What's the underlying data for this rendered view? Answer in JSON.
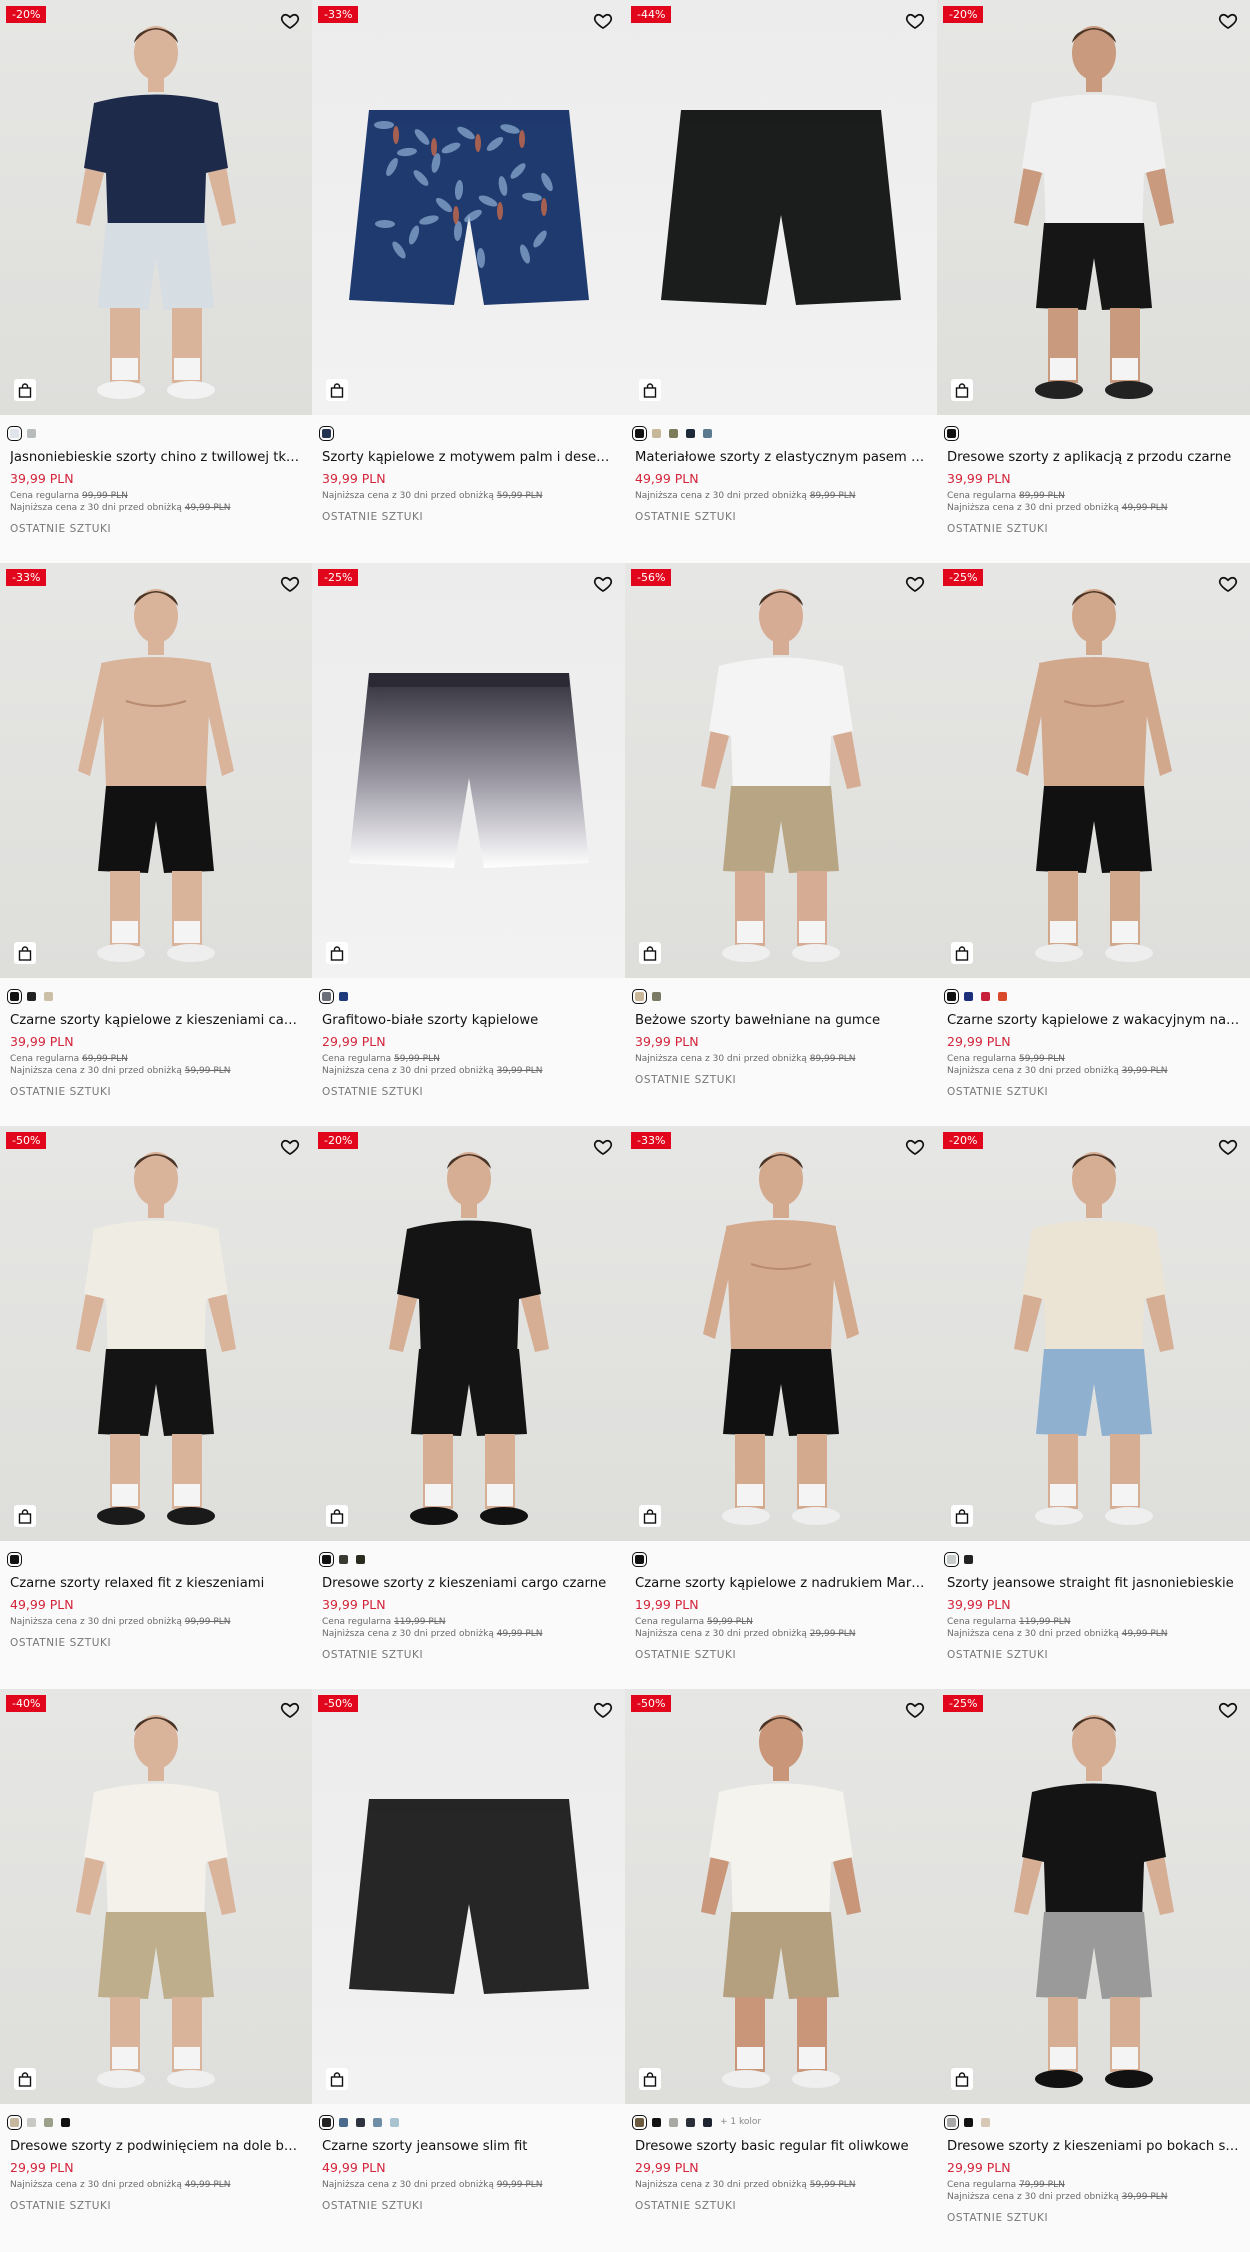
{
  "colors": {
    "sale_badge": "#e1061b",
    "price": "#d3243a",
    "background": "#fafafa"
  },
  "products": [
    {
      "discount": "-20%",
      "name": "Jasnoniebieskie szorty chino z twillowej tkaniny",
      "price": "39,99 PLN",
      "regular_label": "Cena regularna",
      "regular_price": "99,99 PLN",
      "lowest_label": "Najniższa cena z 30 dni przed obniżką",
      "lowest_price": "49,99 PLN",
      "tag": "OSTATNIE SZTUKI",
      "swatches": [
        "#dfe5ea",
        "#b8bbbb"
      ],
      "more": "",
      "image": {
        "type": "model",
        "top": "#1e2a4a",
        "shorts": "#d6dde3",
        "skin": "#d9b39a",
        "shoes": "#f2f2f2"
      }
    },
    {
      "discount": "-33%",
      "name": "Szorty kąpielowe z motywem palm i desek surfingowych",
      "price": "39,99 PLN",
      "regular_label": "",
      "regular_price": "",
      "lowest_label": "Najniższa cena z 30 dni przed obniżką",
      "lowest_price": "59,99 PLN",
      "tag": "OSTATNIE SZTUKI",
      "swatches": [
        "#243350"
      ],
      "more": "",
      "image": {
        "type": "flat",
        "shorts": "#1f3a6e",
        "pattern": "#8fb0d6"
      }
    },
    {
      "discount": "-44%",
      "name": "Materiałowe szorty z elastycznym pasem czarne",
      "price": "49,99 PLN",
      "regular_label": "",
      "regular_price": "",
      "lowest_label": "Najniższa cena z 30 dni przed obniżką",
      "lowest_price": "89,99 PLN",
      "tag": "OSTATNIE SZTUKI",
      "swatches": [
        "#111111",
        "#c8b89a",
        "#7d7c5a",
        "#1e2a3a",
        "#5b7a8e"
      ],
      "more": "",
      "image": {
        "type": "flat",
        "shorts": "#1b1d1c",
        "pattern": ""
      }
    },
    {
      "discount": "-20%",
      "name": "Dresowe szorty z aplikacją z przodu czarne",
      "price": "39,99 PLN",
      "regular_label": "Cena regularna",
      "regular_price": "89,99 PLN",
      "lowest_label": "Najniższa cena z 30 dni przed obniżką",
      "lowest_price": "49,99 PLN",
      "tag": "OSTATNIE SZTUKI",
      "swatches": [
        "#111111"
      ],
      "more": "",
      "image": {
        "type": "model",
        "top": "#f0f0f0",
        "shorts": "#161616",
        "skin": "#c99a7d",
        "shoes": "#222222"
      }
    },
    {
      "discount": "-33%",
      "name": "Czarne szorty kąpielowe z kieszeniami cargo",
      "price": "39,99 PLN",
      "regular_label": "Cena regularna",
      "regular_price": "69,99 PLN",
      "lowest_label": "Najniższa cena z 30 dni przed obniżką",
      "lowest_price": "59,99 PLN",
      "tag": "OSTATNIE SZTUKI",
      "swatches": [
        "#111111",
        "#222222",
        "#cbbfa6"
      ],
      "more": "",
      "image": {
        "type": "shirtless",
        "top": "#d9b39a",
        "shorts": "#111111",
        "skin": "#d9b39a",
        "shoes": ""
      }
    },
    {
      "discount": "-25%",
      "name": "Grafitowo-białe szorty kąpielowe",
      "price": "29,99 PLN",
      "regular_label": "Cena regularna",
      "regular_price": "59,99 PLN",
      "lowest_label": "Najniższa cena z 30 dni przed obniżką",
      "lowest_price": "39,99 PLN",
      "tag": "OSTATNIE SZTUKI",
      "swatches": [
        "#6a6e78",
        "#1d3a7a"
      ],
      "more": "",
      "image": {
        "type": "flat",
        "shorts": "#3a3944",
        "pattern": "gradient"
      }
    },
    {
      "discount": "-56%",
      "name": "Beżowe szorty bawełniane na gumce",
      "price": "39,99 PLN",
      "regular_label": "",
      "regular_price": "",
      "lowest_label": "Najniższa cena z 30 dni przed obniżką",
      "lowest_price": "89,99 PLN",
      "tag": "OSTATNIE SZTUKI",
      "swatches": [
        "#c9b79a",
        "#7a7a66"
      ],
      "more": "",
      "image": {
        "type": "model",
        "top": "#f4f4f4",
        "shorts": "#b8a584",
        "skin": "#d6ad94",
        "shoes": "#efefef"
      }
    },
    {
      "discount": "-25%",
      "name": "Czarne szorty kąpielowe z wakacyjnym nadrukiem",
      "price": "29,99 PLN",
      "regular_label": "Cena regularna",
      "regular_price": "59,99 PLN",
      "lowest_label": "Najniższa cena z 30 dni przed obniżką",
      "lowest_price": "39,99 PLN",
      "tag": "OSTATNIE SZTUKI",
      "swatches": [
        "#111111",
        "#1d2f7a",
        "#c8203a",
        "#d94a2a"
      ],
      "more": "",
      "image": {
        "type": "shirtless",
        "top": "#d2a88c",
        "shorts": "#111111",
        "skin": "#d2a88c",
        "shoes": ""
      }
    },
    {
      "discount": "-50%",
      "name": "Czarne szorty relaxed fit z kieszeniami",
      "price": "49,99 PLN",
      "regular_label": "",
      "regular_price": "",
      "lowest_label": "Najniższa cena z 30 dni przed obniżką",
      "lowest_price": "99,99 PLN",
      "tag": "OSTATNIE SZTUKI",
      "swatches": [
        "#111111"
      ],
      "more": "",
      "image": {
        "type": "model",
        "top": "#efece4",
        "shorts": "#141414",
        "skin": "#d9b39a",
        "shoes": "#1a1a1a"
      }
    },
    {
      "discount": "-20%",
      "name": "Dresowe szorty z kieszeniami cargo czarne",
      "price": "39,99 PLN",
      "regular_label": "Cena regularna",
      "regular_price": "119,99 PLN",
      "lowest_label": "Najniższa cena z 30 dni przed obniżką",
      "lowest_price": "49,99 PLN",
      "tag": "OSTATNIE SZTUKI",
      "swatches": [
        "#111111",
        "#3a3a32",
        "#2a2a1e"
      ],
      "more": "",
      "image": {
        "type": "model",
        "top": "#141414",
        "shorts": "#141414",
        "skin": "#d6ae94",
        "shoes": "#111111"
      }
    },
    {
      "discount": "-33%",
      "name": "Czarne szorty kąpielowe z nadrukiem Marvel",
      "price": "19,99 PLN",
      "regular_label": "Cena regularna",
      "regular_price": "59,99 PLN",
      "lowest_label": "Najniższa cena z 30 dni przed obniżką",
      "lowest_price": "29,99 PLN",
      "tag": "OSTATNIE SZTUKI",
      "swatches": [
        "#111111"
      ],
      "more": "",
      "image": {
        "type": "shirtless",
        "top": "#d4aa8e",
        "shorts": "#111111",
        "skin": "#d4aa8e",
        "shoes": ""
      }
    },
    {
      "discount": "-20%",
      "name": "Szorty jeansowe straight fit jasnoniebieskie",
      "price": "39,99 PLN",
      "regular_label": "Cena regularna",
      "regular_price": "119,99 PLN",
      "lowest_label": "Najniższa cena z 30 dni przed obniżką",
      "lowest_price": "49,99 PLN",
      "tag": "OSTATNIE SZTUKI",
      "swatches": [
        "#c8ccc8",
        "#222222"
      ],
      "more": "",
      "image": {
        "type": "model",
        "top": "#ebe3d3",
        "shorts": "#8fb0cf",
        "skin": "#d6ae94",
        "shoes": "#efefef"
      }
    },
    {
      "discount": "-40%",
      "name": "Dresowe szorty z podwinięciem na dole beżowe",
      "price": "29,99 PLN",
      "regular_label": "",
      "regular_price": "",
      "lowest_label": "Najniższa cena z 30 dni przed obniżką",
      "lowest_price": "49,99 PLN",
      "tag": "OSTATNIE SZTUKI",
      "swatches": [
        "#c6b89e",
        "#c8c8c4",
        "#9aa08a",
        "#111111"
      ],
      "more": "",
      "image": {
        "type": "model",
        "top": "#f3f1ea",
        "shorts": "#bfae8c",
        "skin": "#d9b39a",
        "shoes": "#efefef"
      }
    },
    {
      "discount": "-50%",
      "name": "Czarne szorty jeansowe slim fit",
      "price": "49,99 PLN",
      "regular_label": "",
      "regular_price": "",
      "lowest_label": "Najniższa cena z 30 dni przed obniżką",
      "lowest_price": "99,99 PLN",
      "tag": "OSTATNIE SZTUKI",
      "swatches": [
        "#222222",
        "#4a6a8e",
        "#2e3340",
        "#6f8ea6",
        "#a8c2cf"
      ],
      "more": "",
      "image": {
        "type": "flat",
        "shorts": "#262626",
        "pattern": "denim"
      }
    },
    {
      "discount": "-50%",
      "name": "Dresowe szorty basic regular fit oliwkowe",
      "price": "29,99 PLN",
      "regular_label": "",
      "regular_price": "",
      "lowest_label": "Najniższa cena z 30 dni przed obniżką",
      "lowest_price": "59,99 PLN",
      "tag": "OSTATNIE SZTUKI",
      "swatches": [
        "#6b5a3e",
        "#111111",
        "#a9a9a4",
        "#2a2f3a",
        "#1e2430"
      ],
      "more": "+ 1 kolor",
      "image": {
        "type": "model",
        "top": "#f5f3ee",
        "shorts": "#b4a07e",
        "skin": "#c9967a",
        "shoes": "#efefef"
      }
    },
    {
      "discount": "-25%",
      "name": "Dresowe szorty z kieszeniami po bokach szare",
      "price": "29,99 PLN",
      "regular_label": "Cena regularna",
      "regular_price": "79,99 PLN",
      "lowest_label": "Najniższa cena z 30 dni przed obniżką",
      "lowest_price": "39,99 PLN",
      "tag": "OSTATNIE SZTUKI",
      "swatches": [
        "#a8a8a8",
        "#111111",
        "#d6c8b4"
      ],
      "more": "",
      "image": {
        "type": "model",
        "top": "#141414",
        "shorts": "#9a9a9a",
        "skin": "#d6ae94",
        "shoes": "#111111"
      }
    }
  ]
}
